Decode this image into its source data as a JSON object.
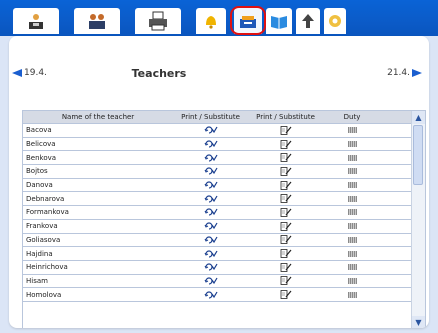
{
  "toolbar": {
    "buttons": [
      {
        "name": "teacher-schedule"
      },
      {
        "name": "groups"
      },
      {
        "name": "print"
      },
      {
        "name": "notifications"
      },
      {
        "name": "substitutions"
      },
      {
        "name": "book"
      },
      {
        "name": "upload"
      },
      {
        "name": "settings"
      }
    ],
    "highlight_color": "#e01010",
    "bar_color": "#0a5ccb"
  },
  "nav": {
    "prev_label": "19.4.",
    "next_label": "21.4.",
    "title": "Teachers"
  },
  "table": {
    "headers": {
      "name": "Name of the teacher",
      "print_sub_1": "Print / Substitute",
      "print_sub_2": "Print / Substitute",
      "duty": "Duty"
    },
    "rows": [
      {
        "name": "Bacova"
      },
      {
        "name": "Belicova"
      },
      {
        "name": "Benkova"
      },
      {
        "name": "Bojtos"
      },
      {
        "name": "Danova"
      },
      {
        "name": "Debnarova"
      },
      {
        "name": "Formankova"
      },
      {
        "name": "Frankova"
      },
      {
        "name": "Goliasova"
      },
      {
        "name": "Hajdina"
      },
      {
        "name": "Heinrichova"
      },
      {
        "name": "Hisam"
      },
      {
        "name": "Homolova"
      }
    ]
  }
}
